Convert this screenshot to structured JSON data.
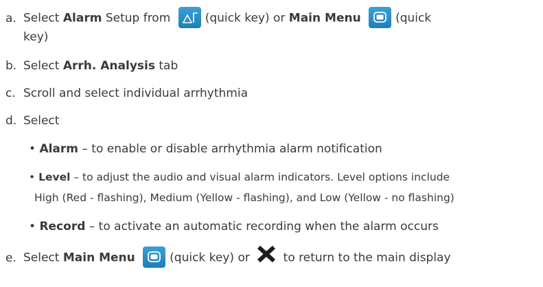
{
  "steps": {
    "a": {
      "letter": "a.",
      "t1": "Select ",
      "alarm_bold": "Alarm",
      "t2": " Setup from",
      "qk1_note": "(quick key) or ",
      "main_menu_bold": "Main Menu",
      "qk2_note": "(quick",
      "cont": "key)"
    },
    "b": {
      "letter": "b.",
      "t1": "Select ",
      "tab_bold": "Arrh. Analysis",
      "t2": " tab"
    },
    "c": {
      "letter": "c.",
      "text": "Scroll and select individual arrhythmia"
    },
    "d": {
      "letter": "d.",
      "text": "Select",
      "bullets": [
        {
          "bold": "Alarm",
          "text": " – to enable or disable arrhythmia alarm notification"
        },
        {
          "bold": "Level",
          "text": " – to adjust the audio and visual alarm indicators. Level options include",
          "cont": "High (Red - flashing), Medium (Yellow - flashing), and Low (Yellow - no flashing)"
        },
        {
          "bold": "Record",
          "text": " – to activate an automatic recording when the alarm occurs"
        }
      ]
    },
    "e": {
      "letter": "e.",
      "t1": "Select ",
      "main_menu_bold": "Main Menu",
      "qk_note": "(quick key) or ",
      "t2": " to return to the main display"
    }
  },
  "icons": {
    "alarm_setup": "alarm-setup-icon",
    "main_menu": "main-menu-icon",
    "close": "close-x-icon"
  },
  "colors": {
    "text": "#3a3a3a",
    "quick_key_bg": "#2a8cc6",
    "close_icon": "#1c1c1c"
  }
}
